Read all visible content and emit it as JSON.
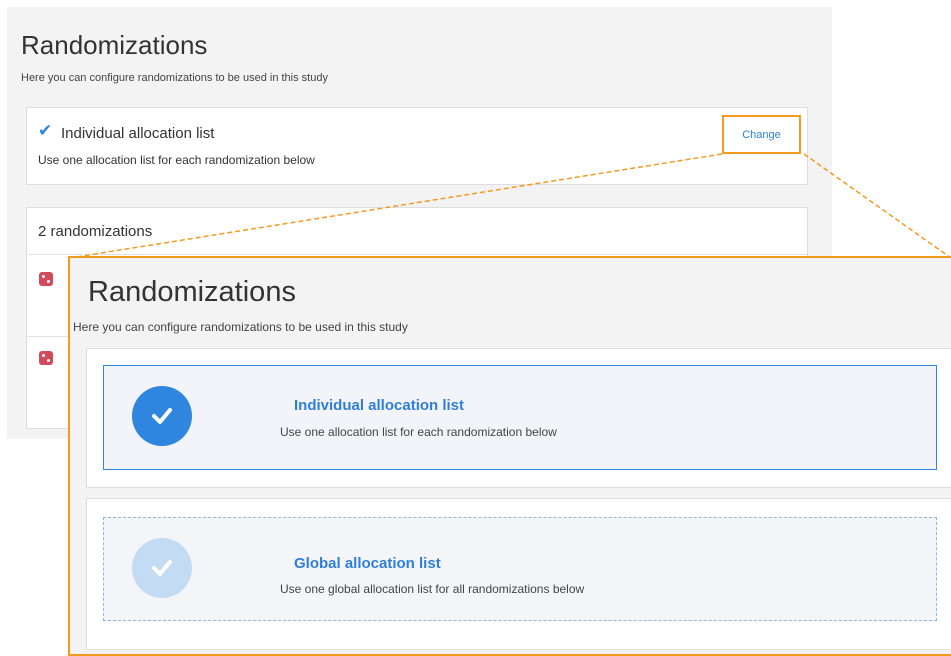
{
  "background": {
    "title": "Randomizations",
    "subtitle": "Here you can configure randomizations to be used in this study",
    "selected_list": {
      "title": "Individual allocation list",
      "description": "Use one allocation list for each randomization below",
      "change_label": "Change"
    },
    "randomizations": {
      "count_label": "2 randomizations",
      "items": [
        {
          "icon": "dice-icon"
        },
        {
          "icon": "dice-icon"
        }
      ]
    }
  },
  "zoom": {
    "title": "Randomizations",
    "subtitle": "Here you can configure randomizations to be used in this study",
    "options": [
      {
        "title": "Individual allocation list",
        "description": "Use one allocation list for each randomization below",
        "selected": true
      },
      {
        "title": "Global allocation list",
        "description": "Use one global allocation list for all randomizations below",
        "selected": false
      }
    ]
  },
  "colors": {
    "accent": "#2f86de",
    "highlight": "#f49a1e",
    "dice": "#d24a5c",
    "link": "#2f7fd8"
  }
}
